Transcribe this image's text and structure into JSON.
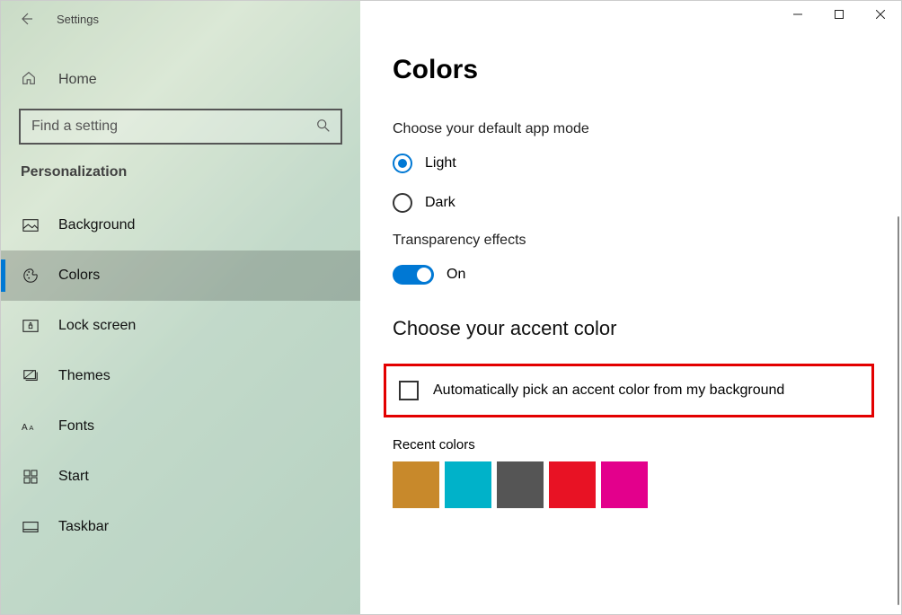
{
  "window": {
    "title": "Settings"
  },
  "sidebar": {
    "home": "Home",
    "search_placeholder": "Find a setting",
    "category": "Personalization",
    "items": [
      {
        "label": "Background",
        "icon": "image-icon"
      },
      {
        "label": "Colors",
        "icon": "palette-icon",
        "selected": true
      },
      {
        "label": "Lock screen",
        "icon": "lock-screen-icon"
      },
      {
        "label": "Themes",
        "icon": "themes-icon"
      },
      {
        "label": "Fonts",
        "icon": "fonts-icon"
      },
      {
        "label": "Start",
        "icon": "start-icon"
      },
      {
        "label": "Taskbar",
        "icon": "taskbar-icon"
      }
    ]
  },
  "main": {
    "heading": "Colors",
    "app_mode": {
      "label": "Choose your default app mode",
      "options": {
        "light": "Light",
        "dark": "Dark"
      },
      "selected": "light"
    },
    "transparency": {
      "label": "Transparency effects",
      "state_label": "On",
      "on": true
    },
    "accent": {
      "heading": "Choose your accent color",
      "auto_label": "Automatically pick an accent color from my background",
      "auto_checked": false
    },
    "recent": {
      "label": "Recent colors",
      "colors": [
        "#c8892b",
        "#00b2c9",
        "#555555",
        "#e81224",
        "#e3008c"
      ]
    }
  }
}
